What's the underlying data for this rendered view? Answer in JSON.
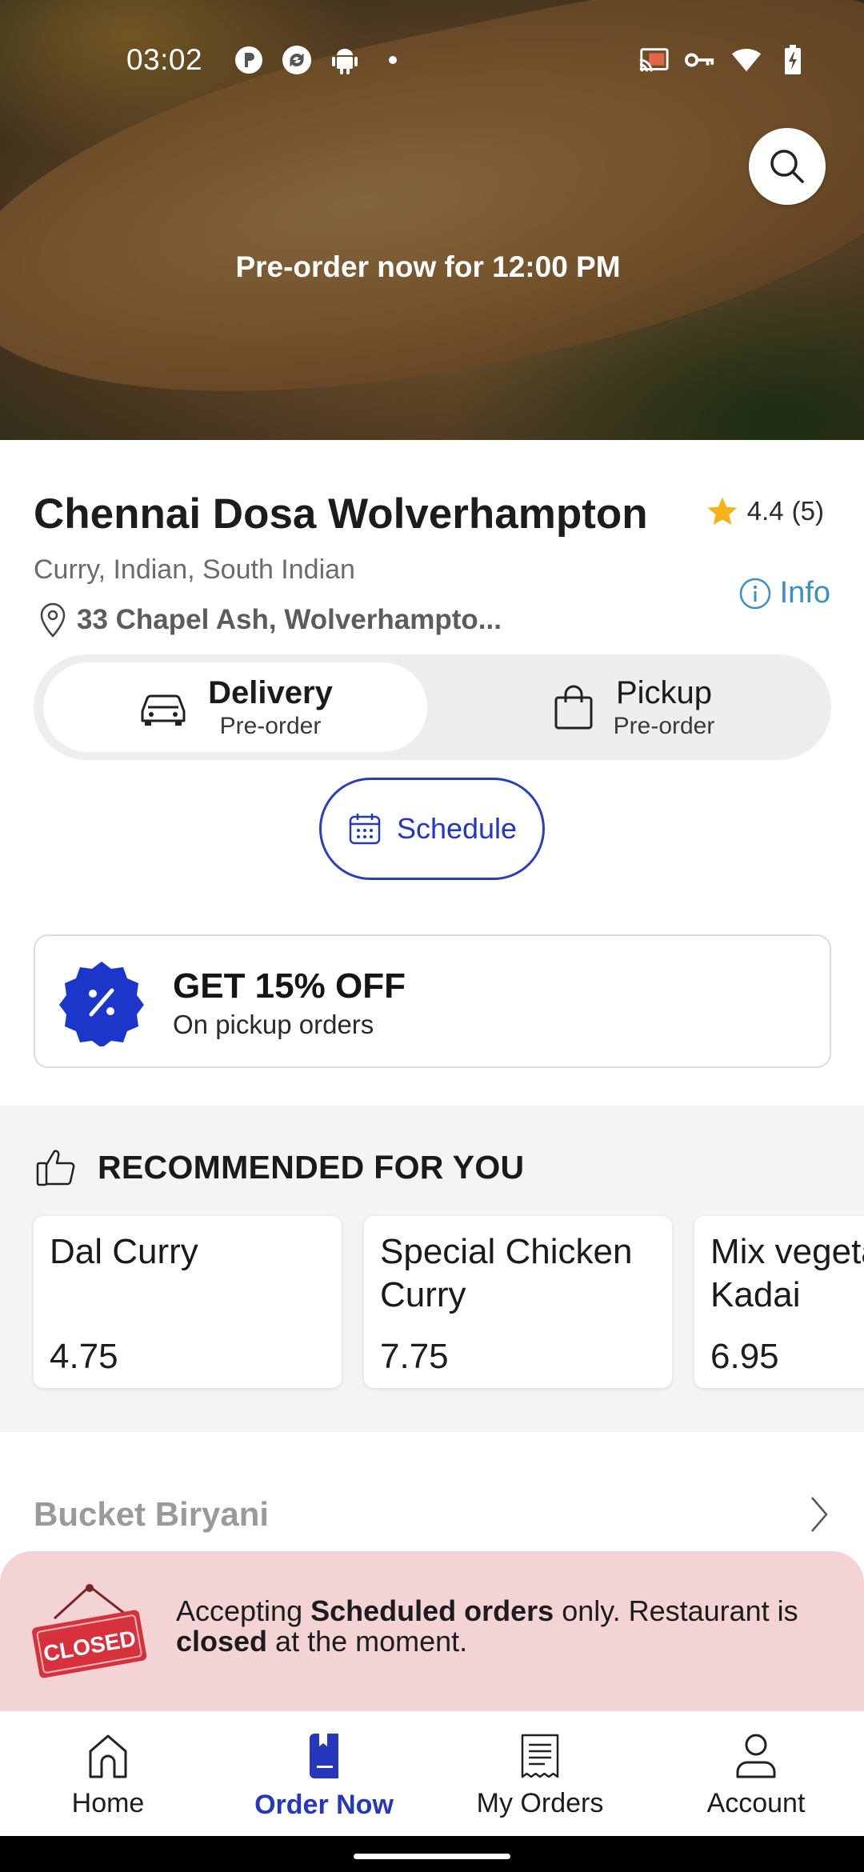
{
  "status_bar": {
    "time": "03:02",
    "left_icons": [
      "p-app-icon",
      "sync-app-icon",
      "android-icon",
      "dot-icon"
    ],
    "right_icons": [
      "cast-icon",
      "vpn-key-icon",
      "wifi-icon",
      "battery-charging-icon"
    ]
  },
  "hero": {
    "preorder_text": "Pre-order now for 12:00 PM",
    "search_icon": "search-icon"
  },
  "restaurant": {
    "name": "Chennai Dosa Wolverhampton",
    "rating": "4.4",
    "rating_count": "(5)",
    "cuisines": "Curry, Indian, South Indian",
    "info_label": "Info",
    "address": "33 Chapel Ash, Wolverhampto..."
  },
  "order_modes": {
    "delivery": {
      "title": "Delivery",
      "subtitle": "Pre-order",
      "icon": "car-icon",
      "selected": true
    },
    "pickup": {
      "title": "Pickup",
      "subtitle": "Pre-order",
      "icon": "shopping-bag-icon",
      "selected": false
    }
  },
  "schedule": {
    "label": "Schedule",
    "icon": "calendar-icon"
  },
  "promo": {
    "title": "GET 15% OFF",
    "subtitle": "On pickup orders",
    "icon": "percent-badge-icon"
  },
  "recommended": {
    "title": "RECOMMENDED FOR YOU",
    "icon": "thumbs-up-icon",
    "items": [
      {
        "name": "Dal Curry",
        "price": "4.75"
      },
      {
        "name": "Special Chicken Curry",
        "price": "7.75"
      },
      {
        "name": "Mix vegetable Kadai",
        "price": "6.95"
      }
    ]
  },
  "category": {
    "name": "Bucket Biryani",
    "icon": "chevron-right-icon"
  },
  "closed_banner": {
    "sign_text": "CLOSED",
    "msg_part1": "Accepting ",
    "msg_bold1": "Scheduled orders",
    "msg_part2": " only. Restaurant is ",
    "msg_bold2": "closed",
    "msg_part3": " at the moment."
  },
  "bottom_nav": {
    "items": [
      {
        "label": "Home",
        "icon": "home-icon",
        "active": false
      },
      {
        "label": "Order Now",
        "icon": "order-book-icon",
        "active": true
      },
      {
        "label": "My Orders",
        "icon": "receipt-icon",
        "active": false
      },
      {
        "label": "Account",
        "icon": "person-icon",
        "active": false
      }
    ]
  },
  "colors": {
    "accent": "#2437bd",
    "info": "#3a8fc4",
    "star": "#f5b21b",
    "closed_bg": "#f4d3d5",
    "closed_sign": "#d6313c"
  }
}
